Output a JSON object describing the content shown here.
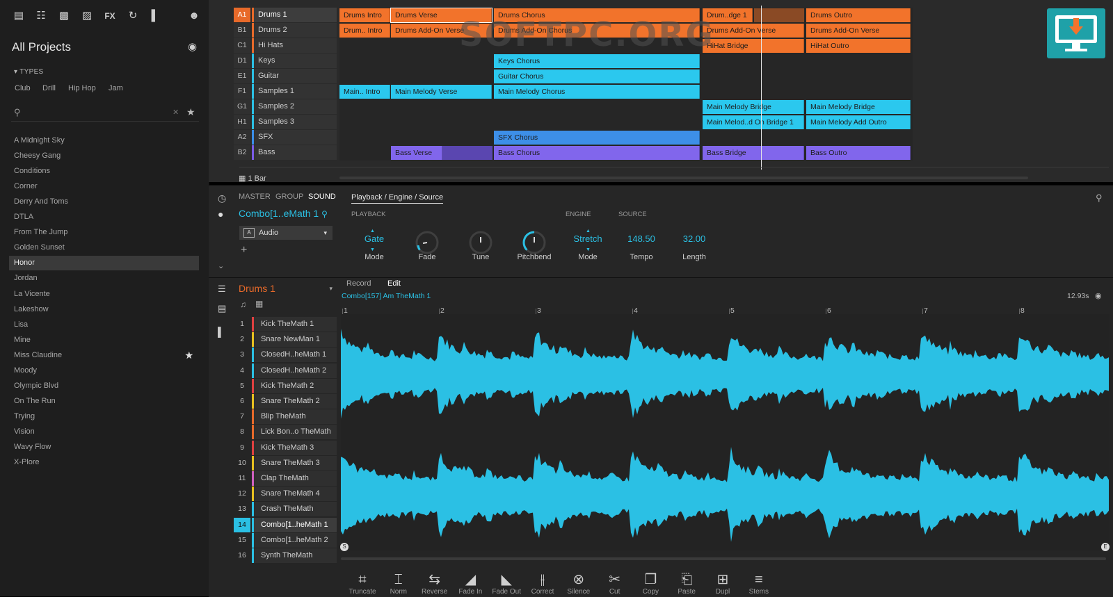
{
  "browser": {
    "title": "All Projects",
    "types_header": "TYPES",
    "types": [
      "Club",
      "Drill",
      "Hip Hop",
      "Jam"
    ],
    "projects": [
      "A Midnight Sky",
      "Cheesy Gang",
      "Conditions",
      "Corner",
      "Derry And Toms",
      "DTLA",
      "From The Jump",
      "Golden Sunset",
      "Honor",
      "Jordan",
      "La Vicente",
      "Lakeshow",
      "Lisa",
      "Mine",
      "Miss Claudine",
      "Moody",
      "Olympic Blvd",
      "On The Run",
      "Trying",
      "Vision",
      "Wavy Flow",
      "X-Plore"
    ],
    "selected_project": "Honor",
    "starred_project": "Miss Claudine"
  },
  "arranger": {
    "tracks": [
      {
        "id": "A1",
        "name": "Drums 1",
        "color": "#e86a2a"
      },
      {
        "id": "B1",
        "name": "Drums 2",
        "color": "#e86a2a"
      },
      {
        "id": "C1",
        "name": "Hi Hats",
        "color": "#e86a2a"
      },
      {
        "id": "D1",
        "name": "Keys",
        "color": "#2bc0e4"
      },
      {
        "id": "E1",
        "name": "Guitar",
        "color": "#2bc0e4"
      },
      {
        "id": "F1",
        "name": "Samples 1",
        "color": "#2bc0e4"
      },
      {
        "id": "G1",
        "name": "Samples 2",
        "color": "#2bc0e4"
      },
      {
        "id": "H1",
        "name": "Samples 3",
        "color": "#2bc0e4"
      },
      {
        "id": "A2",
        "name": "SFX",
        "color": "#3a8ee8"
      },
      {
        "id": "B2",
        "name": "Bass",
        "color": "#7b5ce8"
      }
    ],
    "clips": [
      {
        "label": "Drums Intro",
        "color": "#f2732b"
      },
      {
        "label": "Drums Verse",
        "color": "#f2732b"
      },
      {
        "label": "Drums Chorus",
        "color": "#f2732b"
      },
      {
        "label": "Drum..dge 1",
        "color": "#f2732b"
      },
      {
        "label": "Drums Outro",
        "color": "#f2732b"
      },
      {
        "label": "Drum.. Intro",
        "color": "#f2732b"
      },
      {
        "label": "Drums Add-On Verse",
        "color": "#f2732b"
      },
      {
        "label": "Drums Add-On Chorus",
        "color": "#f2732b"
      },
      {
        "label": "Drums Add-On Verse",
        "color": "#f2732b"
      },
      {
        "label": "Drums Add-On Verse",
        "color": "#f2732b"
      },
      {
        "label": "HiHat Bridge",
        "color": "#f2732b"
      },
      {
        "label": "HiHat Outro",
        "color": "#f2732b"
      },
      {
        "label": "Keys Chorus",
        "color": "#2bc8ee"
      },
      {
        "label": "Guitar Chorus",
        "color": "#2bc8ee"
      },
      {
        "label": "Main.. Intro",
        "color": "#2bc8ee"
      },
      {
        "label": "Main Melody Verse",
        "color": "#2bc8ee"
      },
      {
        "label": "Main Melody Chorus",
        "color": "#2bc8ee"
      },
      {
        "label": "Main Melody Bridge",
        "color": "#2bc8ee"
      },
      {
        "label": "Main Melody Bridge",
        "color": "#2bc8ee"
      },
      {
        "label": "Main Melod..d On Bridge 1",
        "color": "#2bc8ee"
      },
      {
        "label": "Main Melody Add Outro",
        "color": "#2bc8ee"
      },
      {
        "label": "SFX Chorus",
        "color": "#3d8fe8"
      },
      {
        "label": "Bass Verse",
        "color": "#8166ec"
      },
      {
        "label": "Bass Chorus",
        "color": "#8166ec"
      },
      {
        "label": "Bass Bridge",
        "color": "#8166ec"
      },
      {
        "label": "Bass Outro",
        "color": "#8166ec"
      }
    ],
    "grid_label": "1 Bar",
    "watermark": "SOFTPC.ORG"
  },
  "sound_panel": {
    "tabs": [
      "MASTER",
      "GROUP",
      "SOUND"
    ],
    "sound_name": "Combo[1..eMath 1",
    "source_type": "Audio",
    "page_title": "Playback / Engine / Source",
    "sections": {
      "playback": "PLAYBACK",
      "engine": "ENGINE",
      "source": "SOURCE"
    },
    "params": {
      "mode_value": "Gate",
      "mode_label": "Mode",
      "fade_label": "Fade",
      "tune_label": "Tune",
      "pitchbend_label": "Pitchbend",
      "engine_mode_value": "Stretch",
      "engine_mode_label": "Mode",
      "tempo_value": "148.50",
      "tempo_label": "Tempo",
      "length_value": "32.00",
      "length_label": "Length"
    }
  },
  "editor": {
    "group_name": "Drums 1",
    "tabs": [
      "Record",
      "Edit"
    ],
    "sample_name": "Combo[157] Am TheMath 1",
    "duration": "12.93s",
    "bar_numbers": [
      "1",
      "2",
      "3",
      "4",
      "5",
      "6",
      "7",
      "8"
    ],
    "start_marker": "S",
    "end_marker": "E",
    "sounds": [
      {
        "num": "1",
        "name": "Kick TheMath 1",
        "color": "#e04040"
      },
      {
        "num": "2",
        "name": "Snare NewMan 1",
        "color": "#e8c020"
      },
      {
        "num": "3",
        "name": "ClosedH..heMath 1",
        "color": "#2bc0e4"
      },
      {
        "num": "4",
        "name": "ClosedH..heMath 2",
        "color": "#2bc0e4"
      },
      {
        "num": "5",
        "name": "Kick TheMath 2",
        "color": "#e04040"
      },
      {
        "num": "6",
        "name": "Snare TheMath 2",
        "color": "#e8c020"
      },
      {
        "num": "7",
        "name": "Blip TheMath",
        "color": "#e86a2a"
      },
      {
        "num": "8",
        "name": "Lick Bon..o TheMath",
        "color": "#e86a2a"
      },
      {
        "num": "9",
        "name": "Kick TheMath 3",
        "color": "#e04040"
      },
      {
        "num": "10",
        "name": "Snare TheMath 3",
        "color": "#e8c020"
      },
      {
        "num": "11",
        "name": "Clap TheMath",
        "color": "#d060c0"
      },
      {
        "num": "12",
        "name": "Snare TheMath 4",
        "color": "#e8c020"
      },
      {
        "num": "13",
        "name": "Crash TheMath",
        "color": "#2bc0e4"
      },
      {
        "num": "14",
        "name": "Combo[1..heMath 1",
        "color": "#2bc0e4"
      },
      {
        "num": "15",
        "name": "Combo[1..heMath 2",
        "color": "#2bc0e4"
      },
      {
        "num": "16",
        "name": "Synth TheMath",
        "color": "#2bc0e4"
      }
    ],
    "selected_sound": "14",
    "tools": [
      {
        "label": "Truncate",
        "icon": "truncate-icon"
      },
      {
        "label": "Norm",
        "icon": "normalize-icon"
      },
      {
        "label": "Reverse",
        "icon": "reverse-icon"
      },
      {
        "label": "Fade In",
        "icon": "fade-in-icon"
      },
      {
        "label": "Fade Out",
        "icon": "fade-out-icon"
      },
      {
        "label": "Correct",
        "icon": "correct-icon"
      },
      {
        "label": "Silence",
        "icon": "silence-icon"
      },
      {
        "label": "Cut",
        "icon": "cut-icon"
      },
      {
        "label": "Copy",
        "icon": "copy-icon"
      },
      {
        "label": "Paste",
        "icon": "paste-icon"
      },
      {
        "label": "Dupl",
        "icon": "duplicate-icon"
      },
      {
        "label": "Stems",
        "icon": "stems-icon"
      }
    ]
  },
  "colors": {
    "accent": "#2bc0e4",
    "orange": "#f2732b",
    "purple": "#8166ec"
  }
}
